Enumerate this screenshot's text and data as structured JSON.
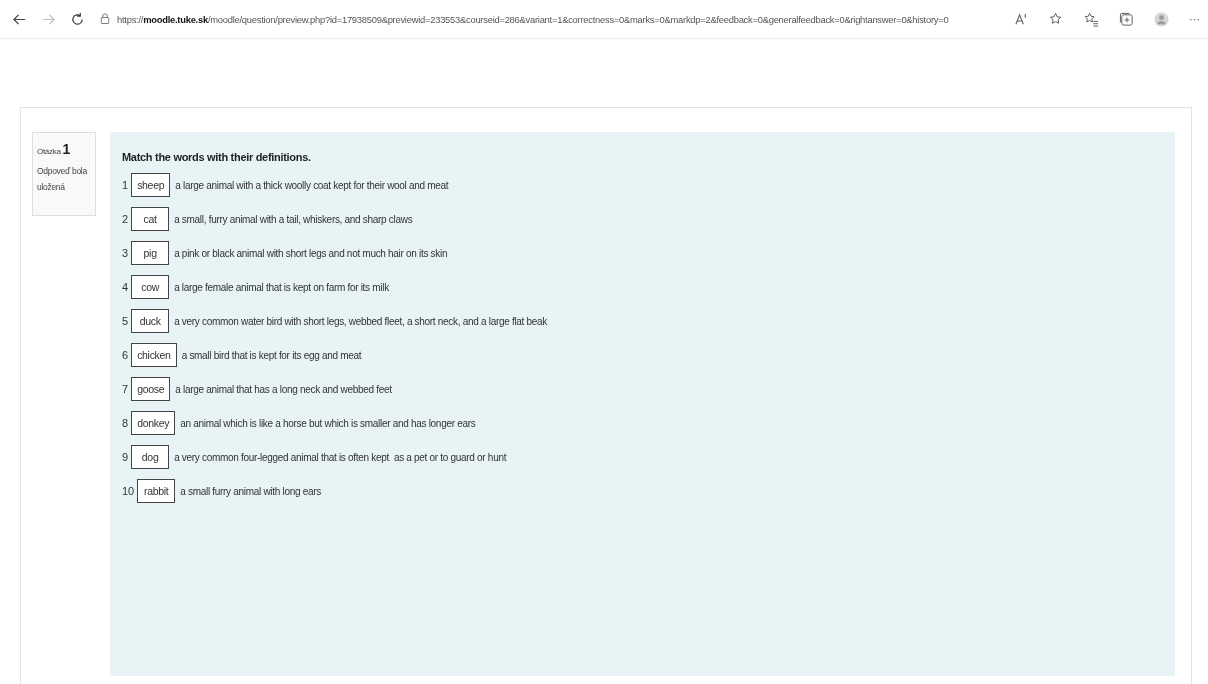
{
  "browser": {
    "url": "https://**moodle.tuke.sk**/moodle/question/preview.php?id=17938509&previewid=233553&courseid=286&variant=1&correctness=0&marks=0&markdp=2&feedback=0&generalfeedback=0&rightanswer=0&history=0",
    "more": "···"
  },
  "info": {
    "label": "Otázka",
    "number": "1",
    "status": "Odpoveď bola uložená"
  },
  "question": {
    "prompt": "Match the words with their definitions.",
    "items": [
      {
        "number": "1",
        "answer": "sheep",
        "definition": "a large animal with a thick woolly coat kept for their wool and meat"
      },
      {
        "number": "2",
        "answer": "cat",
        "definition": "a small, furry animal with a tail, whiskers, and sharp claws"
      },
      {
        "number": "3",
        "answer": "pig",
        "definition": "a pink or black animal with short legs and not much hair on its skin"
      },
      {
        "number": "4",
        "answer": "cow",
        "definition": "a large female animal that is kept on farm for its milk"
      },
      {
        "number": "5",
        "answer": "duck",
        "definition": "a very common water bird with short legs, webbed fleet, a short neck, and a large flat beak"
      },
      {
        "number": "6",
        "answer": "chicken",
        "definition": "a small bird that is kept for its egg and meat"
      },
      {
        "number": "7",
        "answer": "goose",
        "definition": "a large animal that has a long neck and webbed feet"
      },
      {
        "number": "8",
        "answer": "donkey",
        "definition": "an animal which is like a horse but which is smaller and has longer ears"
      },
      {
        "number": "9",
        "answer": "dog",
        "definition": "a very common four-legged animal that is often kept  as a pet or to guard or hunt"
      },
      {
        "number": "10",
        "answer": "rabbit",
        "definition": "a small furry animal with long ears"
      }
    ]
  }
}
